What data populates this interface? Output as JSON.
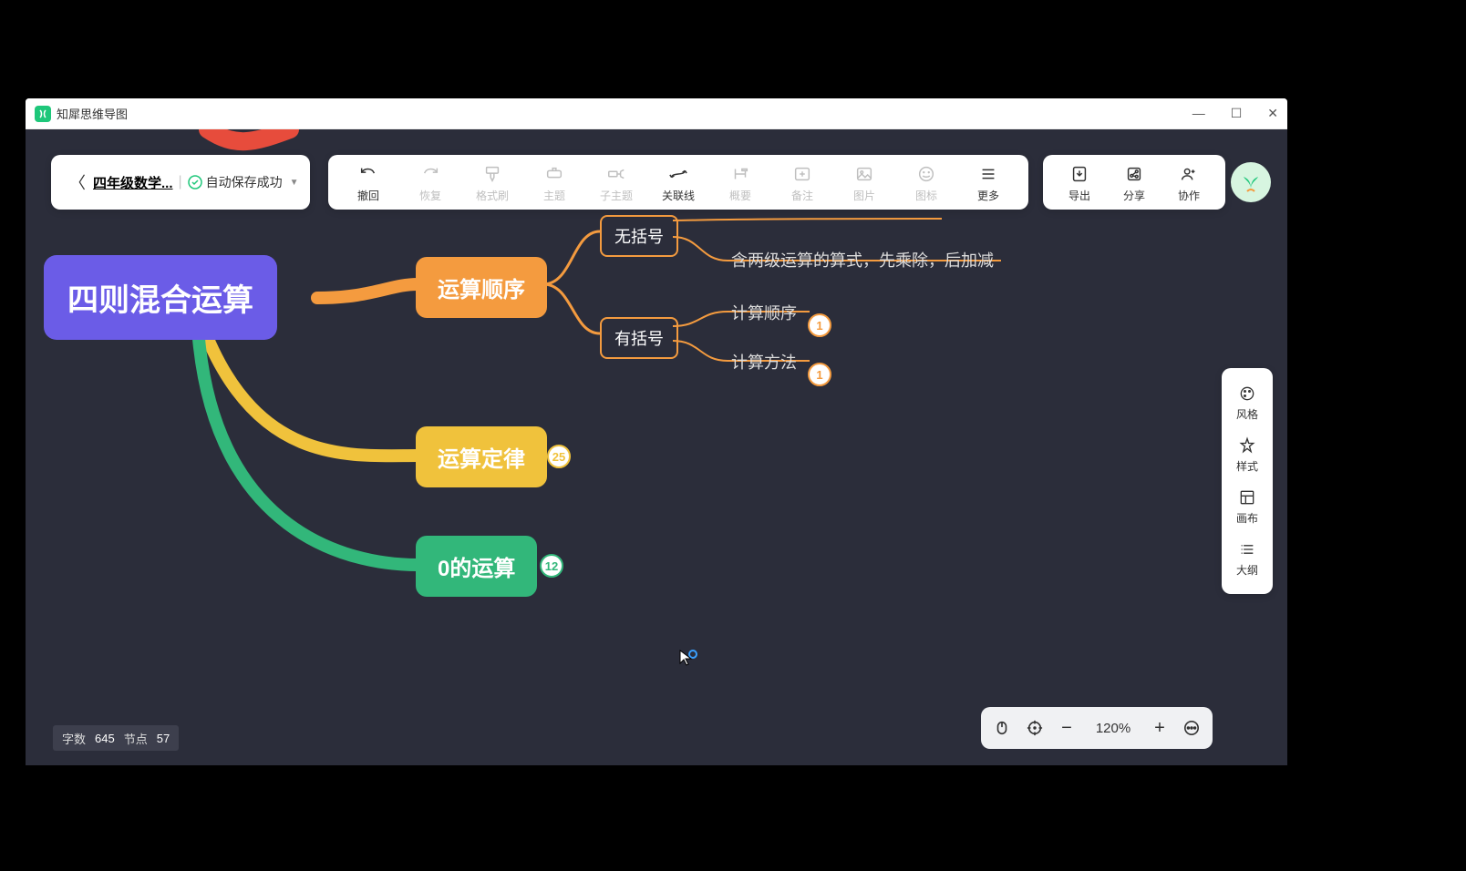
{
  "window": {
    "title": "知犀思维导图"
  },
  "breadcrumb": {
    "doc_name": "四年级数学...",
    "save_status": "自动保存成功"
  },
  "toolbar": {
    "undo": "撤回",
    "redo": "恢复",
    "format_painter": "格式刷",
    "topic": "主题",
    "subtopic": "子主题",
    "relation": "关联线",
    "summary": "概要",
    "note": "备注",
    "image": "图片",
    "icon": "图标",
    "more": "更多"
  },
  "right_toolbar": {
    "export": "导出",
    "share": "分享",
    "collab": "协作"
  },
  "side_panel": {
    "style": "风格",
    "format": "样式",
    "canvas": "画布",
    "outline": "大纲"
  },
  "zoom": {
    "value": "120%"
  },
  "status": {
    "word_label": "字数",
    "word_count": "645",
    "node_label": "节点",
    "node_count": "57"
  },
  "mindmap": {
    "root": "四则混合运算",
    "branch_order": {
      "label": "运算顺序"
    },
    "branch_law": {
      "label": "运算定律",
      "count": "25"
    },
    "branch_zero": {
      "label": "0的运算",
      "count": "12"
    },
    "no_bracket": "无括号",
    "with_bracket": "有括号",
    "rule_text": "含两级运算的算式，先乘除，后加减",
    "calc_order": {
      "label": "计算顺序",
      "count": "1"
    },
    "calc_method": {
      "label": "计算方法",
      "count": "1"
    }
  }
}
